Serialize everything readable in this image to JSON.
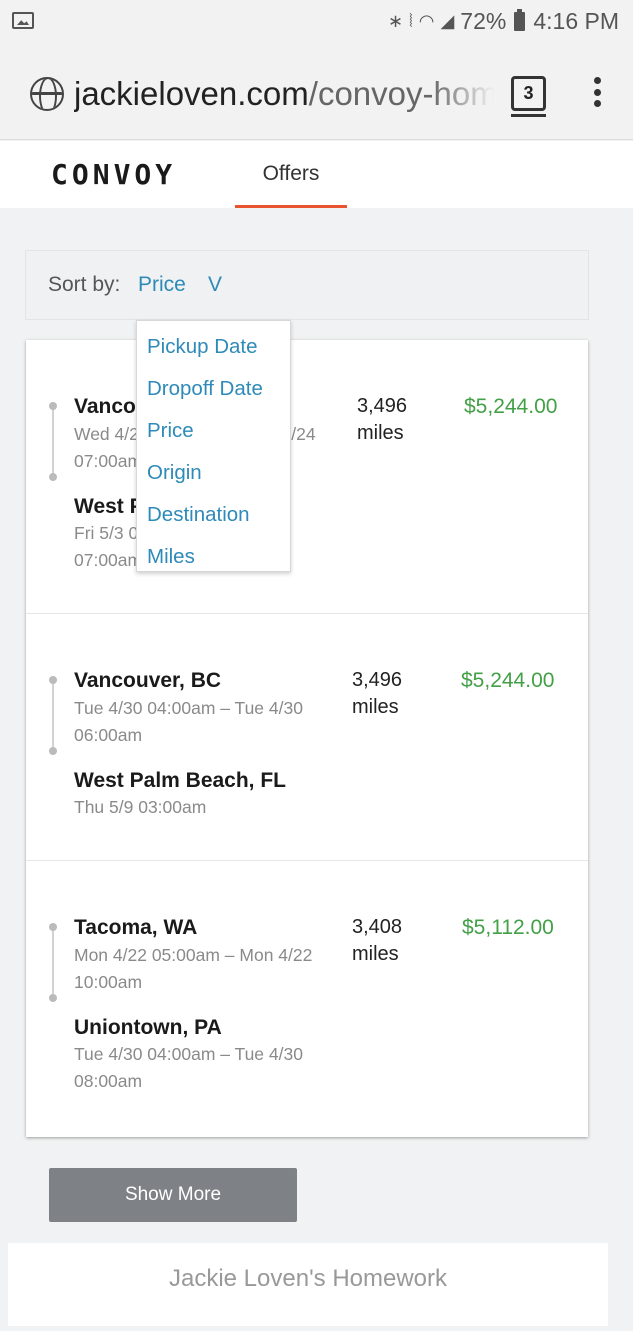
{
  "status_bar": {
    "icons": [
      "image-icon",
      "bluetooth-icon",
      "vibrate-icon",
      "wifi-icon",
      "signal-icon",
      "battery-icon"
    ],
    "battery": "72%",
    "time": "4:16 PM"
  },
  "browser": {
    "url_domain": "jackieloven.com",
    "url_path": "/convoy-home",
    "tab_count": "3"
  },
  "header": {
    "logo": "CONVOY",
    "tabs": [
      {
        "label": "Offers",
        "active": true
      }
    ]
  },
  "sort": {
    "label": "Sort by:",
    "selected": "Price",
    "chevron": "V",
    "options": [
      "Pickup Date",
      "Dropoff Date",
      "Price",
      "Origin",
      "Destination",
      "Miles"
    ]
  },
  "loads": [
    {
      "origin": "Vancouver, BC",
      "origin_time": "Wed 4/24 07:00am – Wed 4/24 07:00am",
      "destination": "West Palm Beach, FL",
      "destination_time": "Fri 5/3 07:00am – Fri 5/3 07:00am",
      "miles_value": "3,496",
      "miles_unit": "miles",
      "price": "$5,244.00"
    },
    {
      "origin": "Vancouver, BC",
      "origin_time": "Tue 4/30 04:00am – Tue 4/30 06:00am",
      "destination": "West Palm Beach, FL",
      "destination_time": "Thu 5/9 03:00am",
      "miles_value": "3,496",
      "miles_unit": "miles",
      "price": "$5,244.00"
    },
    {
      "origin": "Tacoma, WA",
      "origin_time": "Mon 4/22 05:00am – Mon 4/22 10:00am",
      "destination": "Uniontown, PA",
      "destination_time": "Tue 4/30 04:00am – Tue 4/30 08:00am",
      "miles_value": "3,408",
      "miles_unit": "miles",
      "price": "$5,112.00"
    }
  ],
  "actions": {
    "show_more": "Show More"
  },
  "footer": {
    "text": "Jackie Loven's Homework"
  },
  "colors": {
    "accent": "#2e8ab8",
    "price": "#43a047",
    "tab_underline": "#e8542f",
    "button": "#7e8286"
  }
}
